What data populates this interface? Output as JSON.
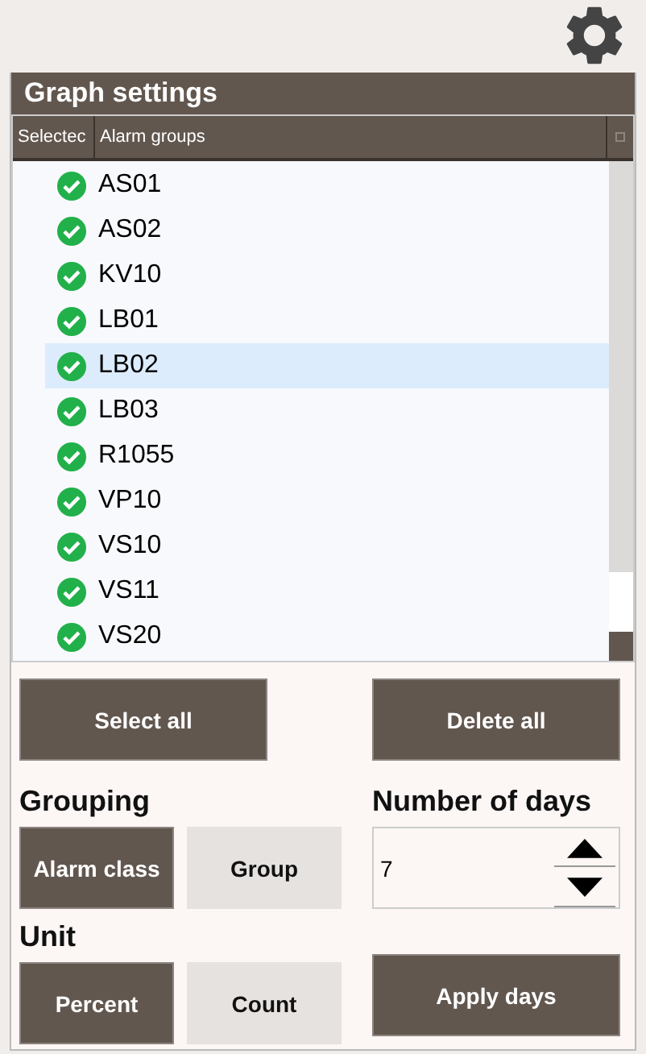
{
  "panel": {
    "title": "Graph settings"
  },
  "table": {
    "columns": [
      "Selectec",
      "Alarm groups"
    ],
    "rows": [
      {
        "name": "AS01",
        "checked": true,
        "selected": false
      },
      {
        "name": "AS02",
        "checked": true,
        "selected": false
      },
      {
        "name": "KV10",
        "checked": true,
        "selected": false
      },
      {
        "name": "LB01",
        "checked": true,
        "selected": false
      },
      {
        "name": "LB02",
        "checked": true,
        "selected": true
      },
      {
        "name": "LB03",
        "checked": true,
        "selected": false
      },
      {
        "name": "R1055",
        "checked": true,
        "selected": false
      },
      {
        "name": "VP10",
        "checked": true,
        "selected": false
      },
      {
        "name": "VS10",
        "checked": true,
        "selected": false
      },
      {
        "name": "VS11",
        "checked": true,
        "selected": false
      },
      {
        "name": "VS20",
        "checked": true,
        "selected": false
      }
    ]
  },
  "select_all_button": "Select all",
  "delete_all_button": "Delete all",
  "grouping": {
    "label": "Grouping",
    "options": [
      {
        "label": "Alarm class",
        "selected": true
      },
      {
        "label": "Group",
        "selected": false
      }
    ]
  },
  "days": {
    "label": "Number of days",
    "value": "7"
  },
  "unit": {
    "label": "Unit",
    "options": [
      {
        "label": "Percent",
        "selected": true
      },
      {
        "label": "Count",
        "selected": false
      }
    ]
  },
  "apply_days_button": "Apply days"
}
